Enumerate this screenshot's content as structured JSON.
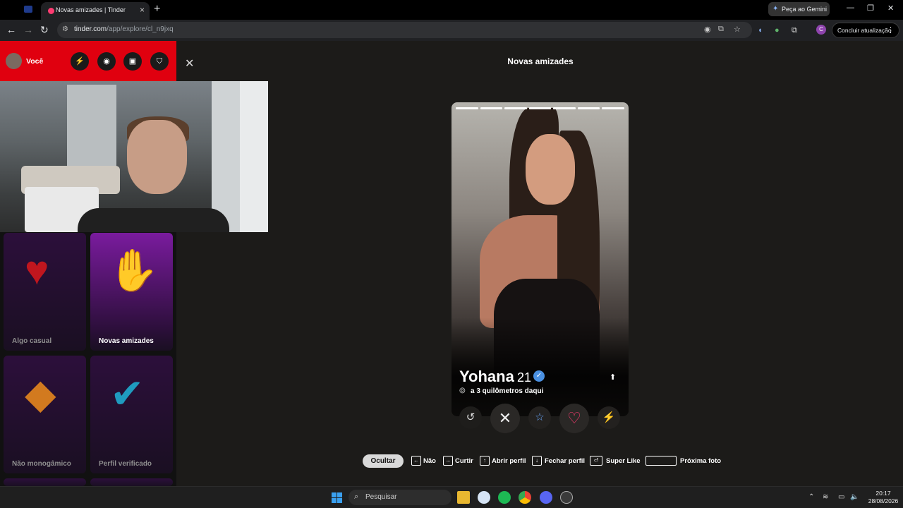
{
  "browser": {
    "tab_title": "Novas amizades | Tinder",
    "new_tab": "+",
    "gemini_label": "Peça ao Gemini",
    "url_host": "tinder.com",
    "url_path": "/app/explore/cl_n9jxq",
    "update_label": "Concluir atualização",
    "profile_initial": "C"
  },
  "sidebar": {
    "you_label": "Você",
    "cards": [
      {
        "label": "Algo casual"
      },
      {
        "label": "Novas amizades"
      },
      {
        "label": "Não monogâmico"
      },
      {
        "label": "Perfil verificado"
      }
    ]
  },
  "page": {
    "title": "Novas amizades"
  },
  "profile": {
    "name": "Yohana",
    "age": "21",
    "distance": "a 3 quilômetros daqui",
    "photo_count": 7,
    "current_photo": 1
  },
  "shortcuts": {
    "hide": "Ocultar",
    "items": [
      {
        "key": "←",
        "label": "Não"
      },
      {
        "key": "→",
        "label": "Curtir"
      },
      {
        "key": "↑",
        "label": "Abrir perfil"
      },
      {
        "key": "↓",
        "label": "Fechar perfil"
      },
      {
        "key": "⏎",
        "label": "Super Like"
      },
      {
        "key": "",
        "label": "Próxima foto"
      }
    ]
  },
  "taskbar": {
    "search_placeholder": "Pesquisar",
    "time": "20:17",
    "date": "28/08/2026"
  },
  "colors": {
    "tinder_red": "#e0000f",
    "like_red": "#fe3c72",
    "boost_purple": "#b26bff"
  }
}
